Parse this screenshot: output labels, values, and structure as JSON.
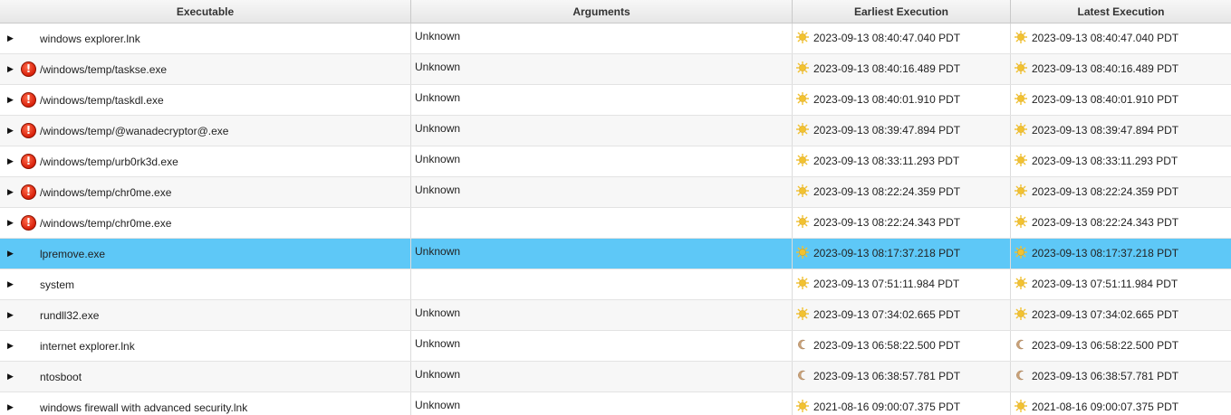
{
  "columns": {
    "executable": "Executable",
    "arguments": "Arguments",
    "earliest": "Earliest Execution",
    "latest": "Latest Execution"
  },
  "rows": [
    {
      "executable": "windows explorer.lnk",
      "arguments": "Unknown",
      "earliest": "2023-09-13 08:40:47.040 PDT",
      "latest": "2023-09-13 08:40:47.040 PDT",
      "warning": false,
      "earliest_icon": "sun-icon",
      "latest_icon": "sun-icon"
    },
    {
      "executable": "/windows/temp/taskse.exe",
      "arguments": "Unknown",
      "earliest": "2023-09-13 08:40:16.489 PDT",
      "latest": "2023-09-13 08:40:16.489 PDT",
      "warning": true,
      "earliest_icon": "sun-icon",
      "latest_icon": "sun-icon"
    },
    {
      "executable": "/windows/temp/taskdl.exe",
      "arguments": "Unknown",
      "earliest": "2023-09-13 08:40:01.910 PDT",
      "latest": "2023-09-13 08:40:01.910 PDT",
      "warning": true,
      "earliest_icon": "sun-icon",
      "latest_icon": "sun-icon"
    },
    {
      "executable": "/windows/temp/@wanadecryptor@.exe",
      "arguments": "Unknown",
      "earliest": "2023-09-13 08:39:47.894 PDT",
      "latest": "2023-09-13 08:39:47.894 PDT",
      "warning": true,
      "earliest_icon": "sun-icon",
      "latest_icon": "sun-icon"
    },
    {
      "executable": "/windows/temp/urb0rk3d.exe",
      "arguments": "Unknown",
      "earliest": "2023-09-13 08:33:11.293 PDT",
      "latest": "2023-09-13 08:33:11.293 PDT",
      "warning": true,
      "earliest_icon": "sun-icon",
      "latest_icon": "sun-icon"
    },
    {
      "executable": "/windows/temp/chr0me.exe",
      "arguments": "Unknown",
      "earliest": "2023-09-13 08:22:24.359 PDT",
      "latest": "2023-09-13 08:22:24.359 PDT",
      "warning": true,
      "earliest_icon": "sun-icon",
      "latest_icon": "sun-icon"
    },
    {
      "executable": "/windows/temp/chr0me.exe",
      "arguments": "",
      "earliest": "2023-09-13 08:22:24.343 PDT",
      "latest": "2023-09-13 08:22:24.343 PDT",
      "warning": true,
      "earliest_icon": "sun-icon",
      "latest_icon": "sun-icon"
    },
    {
      "executable": "lpremove.exe",
      "arguments": "Unknown",
      "earliest": "2023-09-13 08:17:37.218 PDT",
      "latest": "2023-09-13 08:17:37.218 PDT",
      "warning": false,
      "earliest_icon": "sun-icon",
      "latest_icon": "sun-icon",
      "selected": true
    },
    {
      "executable": "system",
      "arguments": "",
      "earliest": "2023-09-13 07:51:11.984 PDT",
      "latest": "2023-09-13 07:51:11.984 PDT",
      "warning": false,
      "earliest_icon": "sun-icon",
      "latest_icon": "sun-icon"
    },
    {
      "executable": "rundll32.exe",
      "arguments": "Unknown",
      "earliest": "2023-09-13 07:34:02.665 PDT",
      "latest": "2023-09-13 07:34:02.665 PDT",
      "warning": false,
      "earliest_icon": "sun-icon",
      "latest_icon": "sun-icon"
    },
    {
      "executable": "internet explorer.lnk",
      "arguments": "Unknown",
      "earliest": "2023-09-13 06:58:22.500 PDT",
      "latest": "2023-09-13 06:58:22.500 PDT",
      "warning": false,
      "earliest_icon": "moon-icon",
      "latest_icon": "moon-icon"
    },
    {
      "executable": "ntosboot",
      "arguments": "Unknown",
      "earliest": "2023-09-13 06:38:57.781 PDT",
      "latest": "2023-09-13 06:38:57.781 PDT",
      "warning": false,
      "earliest_icon": "moon-icon",
      "latest_icon": "moon-icon"
    },
    {
      "executable": "windows firewall with advanced security.lnk",
      "arguments": "Unknown",
      "earliest": "2021-08-16 09:00:07.375 PDT",
      "latest": "2021-08-16 09:00:07.375 PDT",
      "warning": false,
      "earliest_icon": "sun-icon",
      "latest_icon": "sun-icon"
    }
  ],
  "colors": {
    "selected_row": "#5ec8f7",
    "warning": "#d8200a",
    "sun": "#f2c230",
    "moon": "#c9a27a"
  },
  "glyphs": {
    "expander": "▶",
    "warning": "!"
  }
}
